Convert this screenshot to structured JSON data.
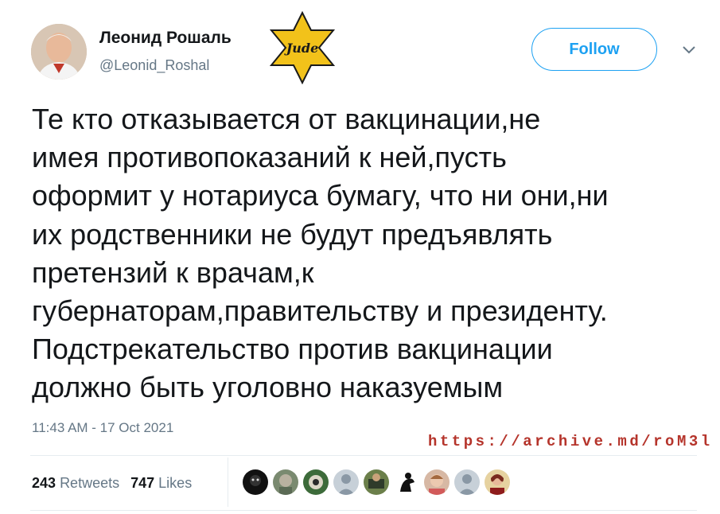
{
  "author": {
    "name": "Леонид Рошаль",
    "handle": "@Leonid_Roshal"
  },
  "star_badge": {
    "text": "Jude"
  },
  "follow_label": "Follow",
  "tweet": {
    "text": "Те кто отказывается от вакцинации,не\nимея противопоказаний к ней,пусть\nоформит у нотариуса бумагу, что ни они,ни\nих родственники не будут предъявлять\nпретензий к врачам,к\nгубернаторам,правительству и президенту.\nПодстрекательство против вакцинации\nдолжно быть уголовно наказуемым",
    "timestamp": "11:43 AM - 17 Oct 2021"
  },
  "archive_url": "https://archive.md/roM3l",
  "stats": {
    "retweets_count": "243",
    "retweets_label": "Retweets",
    "likes_count": "747",
    "likes_label": "Likes"
  },
  "colors": {
    "accent": "#1da1f2",
    "secondary_text": "#657786",
    "archive_red": "#b5342b",
    "star_yellow": "#f2c21a"
  }
}
